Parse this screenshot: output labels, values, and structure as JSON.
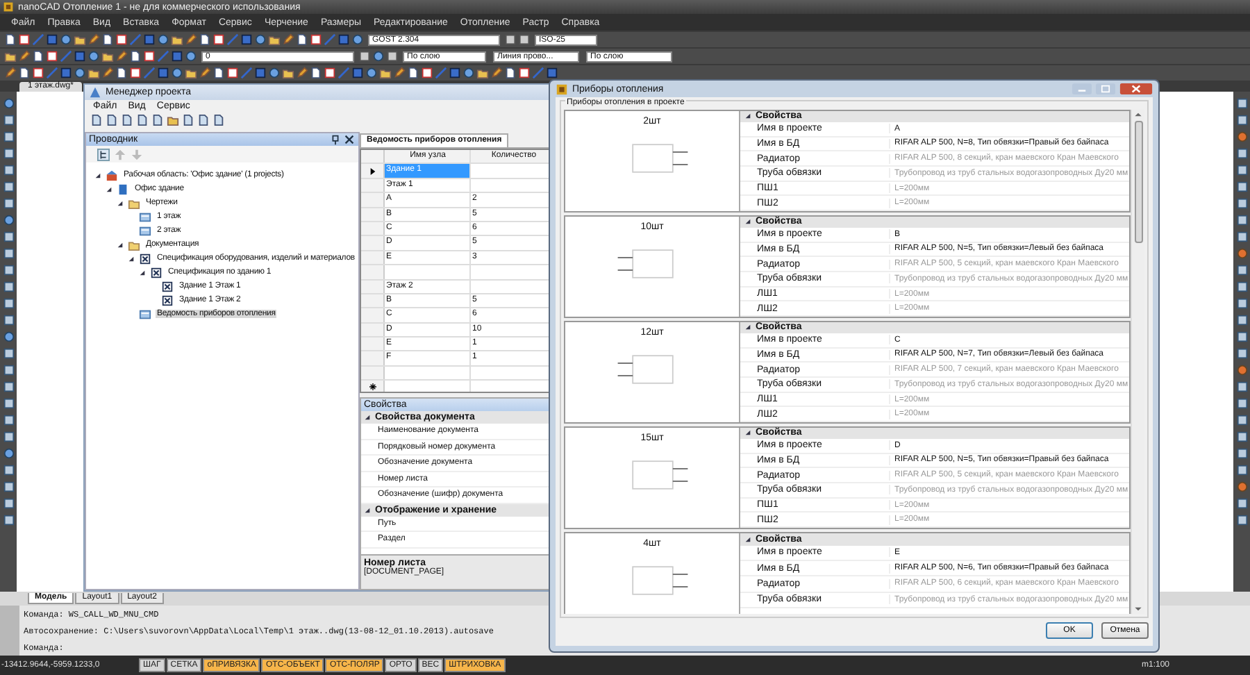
{
  "window": {
    "title": "nanoCAD Отопление 1 - не для коммерческого использования"
  },
  "menu": [
    "Файл",
    "Правка",
    "Вид",
    "Вставка",
    "Формат",
    "Сервис",
    "Черчение",
    "Размеры",
    "Редактирование",
    "Отопление",
    "Растр",
    "Справка"
  ],
  "toolbar_row_1_fields": [
    "GOST 2.304",
    "ISO-25"
  ],
  "toolbar_row_2_fields": [
    "0",
    "По слою",
    "Линия прово...",
    "По слою"
  ],
  "doc_tabs": [
    "1 этаж.dwg*"
  ],
  "project_manager": {
    "title": "Менеджер проекта",
    "menu": [
      "Файл",
      "Вид",
      "Сервис"
    ],
    "explorer_title": "Проводник",
    "tree": [
      {
        "label": "Рабочая область: 'Офис здание' (1 projects)",
        "kind": "workspace",
        "selected": false,
        "children": [
          {
            "label": "Офис здание",
            "kind": "project",
            "selected": false,
            "children": [
              {
                "label": "Чертежи",
                "kind": "folder",
                "selected": false,
                "children": [
                  {
                    "label": "1 этаж",
                    "kind": "drawing",
                    "selected": false
                  },
                  {
                    "label": "2 этаж",
                    "kind": "drawing",
                    "selected": false
                  }
                ]
              },
              {
                "label": "Документация",
                "kind": "folder",
                "selected": false,
                "children": [
                  {
                    "label": "Спецификация оборудования, изделий и материалов",
                    "kind": "spec",
                    "selected": false,
                    "children": [
                      {
                        "label": "Спецификация по зданию 1",
                        "kind": "spec",
                        "selected": false,
                        "children": [
                          {
                            "label": "Здание 1 Этаж 1",
                            "kind": "spec",
                            "selected": false
                          },
                          {
                            "label": "Здание 1 Этаж 2",
                            "kind": "spec",
                            "selected": false
                          }
                        ]
                      }
                    ]
                  },
                  {
                    "label": "Ведомость приборов отопления",
                    "kind": "drawing",
                    "selected": true
                  }
                ]
              }
            ]
          }
        ]
      }
    ],
    "doc_tab": "Ведомость приборов отопления",
    "table": {
      "columns": [
        "Имя узла",
        "Количество"
      ],
      "rows": [
        {
          "name": "Здание 1",
          "selected": true
        },
        {
          "name": "Этаж 1",
          "selected": false
        },
        {
          "name": "A",
          "count": "2",
          "selected": false
        },
        {
          "name": "B",
          "count": "5",
          "selected": false
        },
        {
          "name": "C",
          "count": "6",
          "selected": false
        },
        {
          "name": "D",
          "count": "5",
          "selected": false
        },
        {
          "name": "E",
          "count": "3",
          "selected": false
        },
        {
          "selected": false
        },
        {
          "name": "Этаж 2",
          "selected": false
        },
        {
          "name": "B",
          "count": "5",
          "selected": false
        },
        {
          "name": "C",
          "count": "6",
          "selected": false
        },
        {
          "name": "D",
          "count": "10",
          "selected": false
        },
        {
          "name": "E",
          "count": "1",
          "selected": false
        },
        {
          "name": "F",
          "count": "1",
          "selected": false
        },
        {
          "selected": false
        }
      ]
    },
    "properties": {
      "title": "Свойства",
      "groups": [
        {
          "name": "Свойства документа",
          "items": [
            "Наименование документа",
            "Порядковый номер документа",
            "Обозначение документа",
            "Номер листа",
            "Обозначение (шифр) документа"
          ]
        },
        {
          "name": "Отображение и хранение",
          "items": [
            "Путь",
            "Раздел"
          ]
        }
      ],
      "description_title": "Номер листа",
      "description_text": "[DOCUMENT_PAGE]"
    }
  },
  "dialog": {
    "title": "Приборы отопления",
    "group": "Приборы отопления в проекте",
    "devices": [
      {
        "count": "2шт",
        "pipes_right": true,
        "section": "Свойства",
        "props": [
          {
            "name": "Имя в проекте",
            "value": "A",
            "readonly": false
          },
          {
            "name": "Имя в БД",
            "value": "RIFAR ALP 500, N=8, Тип обвязки=Правый без байпаса",
            "readonly": false
          },
          {
            "name": "Радиатор",
            "value": "RIFAR ALP 500, 8 секций, кран маевского Кран Маевского",
            "readonly": true
          },
          {
            "name": "Труба обвязки",
            "value": "Трубопровод из труб стальных водогазопроводных Ду20 мм",
            "readonly": true
          },
          {
            "name": "ПШ1",
            "value": "L=200мм",
            "readonly": true
          },
          {
            "name": "ПШ2",
            "value": "L=200мм",
            "readonly": true
          }
        ]
      },
      {
        "count": "10шт",
        "pipes_right": false,
        "section": "Свойства",
        "props": [
          {
            "name": "Имя в проекте",
            "value": "B",
            "readonly": false
          },
          {
            "name": "Имя в БД",
            "value": "RIFAR ALP 500, N=5, Тип обвязки=Левый без байпаса",
            "readonly": false
          },
          {
            "name": "Радиатор",
            "value": "RIFAR ALP 500, 5 секций, кран маевского Кран Маевского",
            "readonly": true
          },
          {
            "name": "Труба обвязки",
            "value": "Трубопровод из труб стальных водогазопроводных Ду20 мм",
            "readonly": true
          },
          {
            "name": "ЛШ1",
            "value": "L=200мм",
            "readonly": true
          },
          {
            "name": "ЛШ2",
            "value": "L=200мм",
            "readonly": true
          }
        ]
      },
      {
        "count": "12шт",
        "pipes_right": false,
        "section": "Свойства",
        "props": [
          {
            "name": "Имя в проекте",
            "value": "C",
            "readonly": false
          },
          {
            "name": "Имя в БД",
            "value": "RIFAR ALP 500, N=7, Тип обвязки=Левый без байпаса",
            "readonly": false
          },
          {
            "name": "Радиатор",
            "value": "RIFAR ALP 500, 7 секций, кран маевского Кран Маевского",
            "readonly": true
          },
          {
            "name": "Труба обвязки",
            "value": "Трубопровод из труб стальных водогазопроводных Ду20 мм",
            "readonly": true
          },
          {
            "name": "ЛШ1",
            "value": "L=200мм",
            "readonly": true
          },
          {
            "name": "ЛШ2",
            "value": "L=200мм",
            "readonly": true
          }
        ]
      },
      {
        "count": "15шт",
        "pipes_right": true,
        "section": "Свойства",
        "props": [
          {
            "name": "Имя в проекте",
            "value": "D",
            "readonly": false
          },
          {
            "name": "Имя в БД",
            "value": "RIFAR ALP 500, N=5, Тип обвязки=Правый без байпаса",
            "readonly": false
          },
          {
            "name": "Радиатор",
            "value": "RIFAR ALP 500, 5 секций, кран маевского Кран Маевского",
            "readonly": true
          },
          {
            "name": "Труба обвязки",
            "value": "Трубопровод из труб стальных водогазопроводных Ду20 мм",
            "readonly": true
          },
          {
            "name": "ПШ1",
            "value": "L=200мм",
            "readonly": true
          },
          {
            "name": "ПШ2",
            "value": "L=200мм",
            "readonly": true
          }
        ]
      },
      {
        "count": "4шт",
        "pipes_right": true,
        "section": "Свойства",
        "props": [
          {
            "name": "Имя в проекте",
            "value": "E",
            "readonly": false
          },
          {
            "name": "Имя в БД",
            "value": "RIFAR ALP 500, N=6, Тип обвязки=Правый без байпаса",
            "readonly": false
          },
          {
            "name": "Радиатор",
            "value": "RIFAR ALP 500, 6 секций, кран маевского Кран Маевского",
            "readonly": true
          },
          {
            "name": "Труба обвязки",
            "value": "Трубопровод из труб стальных водогазопроводных Ду20 мм",
            "readonly": true
          }
        ]
      }
    ],
    "buttons": [
      "OK",
      "Отмена"
    ]
  },
  "layout_tabs": [
    {
      "label": "Модель",
      "selected": true
    },
    {
      "label": "Layout1",
      "selected": false
    },
    {
      "label": "Layout2",
      "selected": false
    }
  ],
  "command_lines": [
    "Команда: WS_CALL_WD_MNU_CMD",
    "Автосохранение: C:\\Users\\suvorovn\\AppData\\Local\\Temp\\1 этаж..dwg(13-08-12_01.10.2013).autosave",
    "Команда:"
  ],
  "status_bar": {
    "coordinates": "-13412.9644,-5959.1233,0",
    "toggles": [
      {
        "label": "ШАГ",
        "on": false
      },
      {
        "label": "СЕТКА",
        "on": false
      },
      {
        "label": "оПРИВЯЗКА",
        "on": true
      },
      {
        "label": "ОТС-ОБЪЕКТ",
        "on": true
      },
      {
        "label": "ОТС-ПОЛЯР",
        "on": true
      },
      {
        "label": "ОРТО",
        "on": false
      },
      {
        "label": "ВЕС",
        "on": false
      },
      {
        "label": "ШТРИХОВКА",
        "on": true
      }
    ],
    "scale": "m1:100"
  }
}
